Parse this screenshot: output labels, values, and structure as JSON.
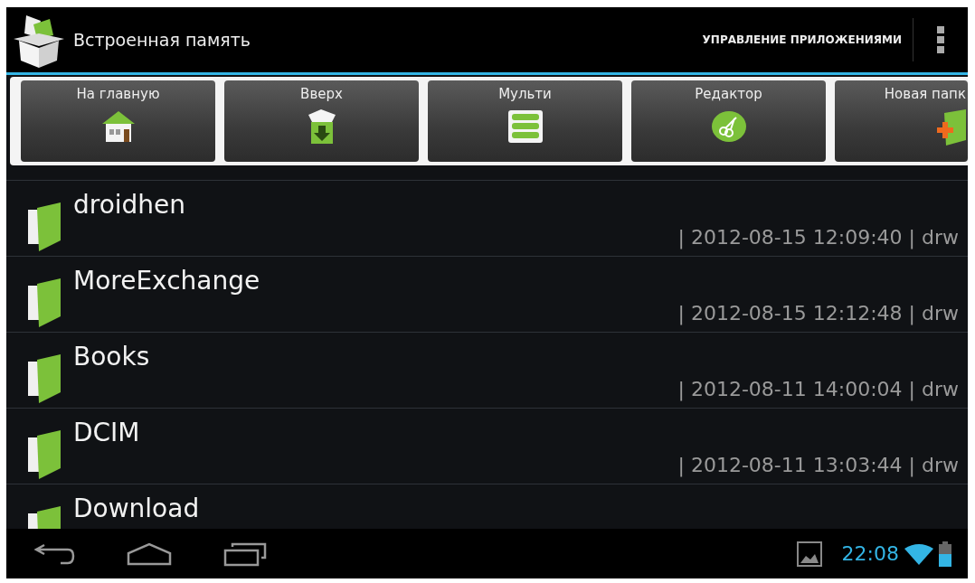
{
  "action_bar": {
    "title": "Встроенная память",
    "action": "УПРАВЛЕНИЕ ПРИЛОЖЕНИЯМИ"
  },
  "toolbar": [
    {
      "label": "На главную",
      "kind": "home"
    },
    {
      "label": "Вверх",
      "kind": "up"
    },
    {
      "label": "Мульти",
      "kind": "multi"
    },
    {
      "label": "Редактор",
      "kind": "editor"
    },
    {
      "label": "Новая папк",
      "kind": "new-folder"
    }
  ],
  "files": [
    {
      "name": "droidhen",
      "details": "| 2012-08-15 12:09:40 | drw"
    },
    {
      "name": "MoreExchange",
      "details": "| 2012-08-15 12:12:48 | drw"
    },
    {
      "name": "Books",
      "details": "| 2012-08-11 14:00:04 | drw"
    },
    {
      "name": "DCIM",
      "details": "| 2012-08-11 13:03:44 | drw"
    },
    {
      "name": "Download"
    }
  ],
  "status_bar": {
    "time": "22:08"
  }
}
